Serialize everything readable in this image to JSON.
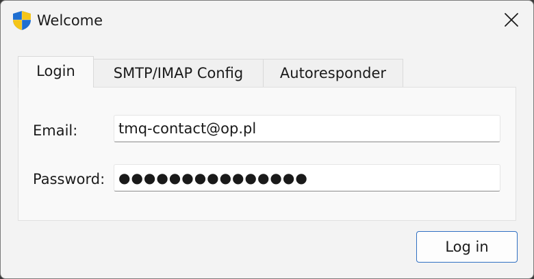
{
  "window": {
    "title": "Welcome",
    "icon": "shield-icon",
    "close_icon": "close-icon"
  },
  "tabs": [
    {
      "label": "Login",
      "active": true
    },
    {
      "label": "SMTP/IMAP Config",
      "active": false
    },
    {
      "label": "Autoresponder",
      "active": false
    }
  ],
  "form": {
    "email_label": "Email:",
    "email_value": "tmq-contact@op.pl",
    "password_label": "Password:",
    "password_value": "●●●●●●●●●●●●●●●"
  },
  "buttons": {
    "login_label": "Log in"
  },
  "colors": {
    "window_bg": "#f3f3f3",
    "panel_bg": "#f9f9f9",
    "accent_border": "#2f6fc2",
    "shield_blue": "#1f6fd1",
    "shield_yellow": "#f5c518"
  }
}
